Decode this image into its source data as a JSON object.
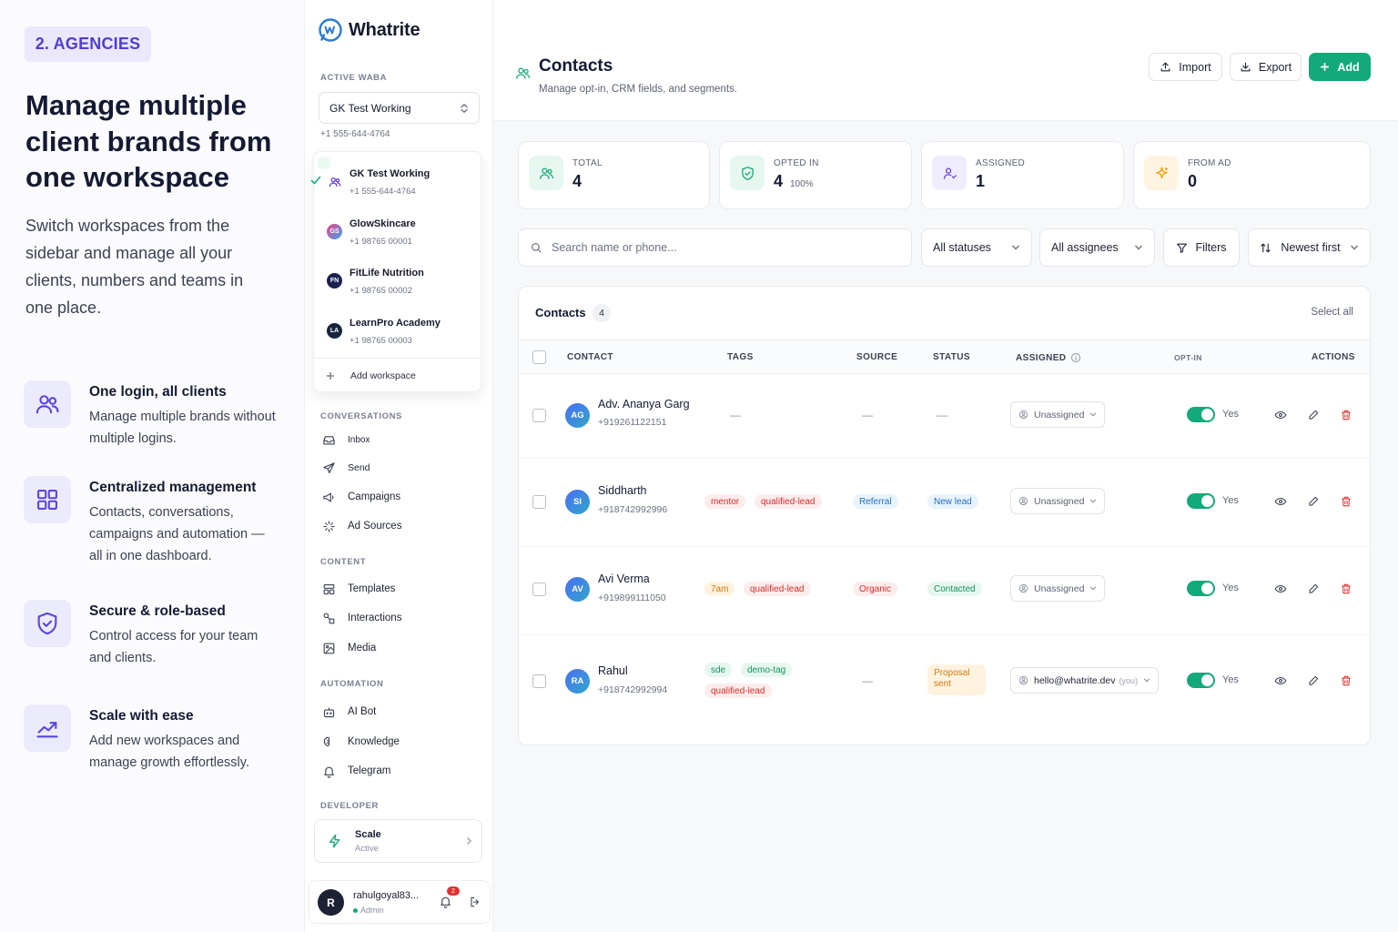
{
  "marketing": {
    "badge": "2. AGENCIES",
    "headline": "Manage multiple client brands from one workspace",
    "lead": "Switch workspaces from the sidebar and manage all your clients, numbers and teams in one place.",
    "features": [
      {
        "icon": "users-icon",
        "title": "One login, all clients",
        "desc": "Manage multiple brands without multiple logins."
      },
      {
        "icon": "grid-icon",
        "title": "Centralized management",
        "desc": "Contacts, conversations, campaigns and automation — all in one dashboard."
      },
      {
        "icon": "shield-check-icon",
        "title": "Secure & role-based",
        "desc": "Control access for your team and clients."
      },
      {
        "icon": "trend-up-icon",
        "title": "Scale with ease",
        "desc": "Add new workspaces and manage growth effortlessly."
      }
    ]
  },
  "sidebar": {
    "brand": "Whatrite",
    "active_waba_label": "ACTIVE WABA",
    "selected_workspace": "GK Test Working",
    "selected_phone": "+1 555-644-4764",
    "workspaces": [
      {
        "name": "GK Test Working",
        "phone": "+1 555-644-4764",
        "initials": "",
        "active": true
      },
      {
        "name": "GlowSkincare",
        "phone": "+1 98765 00001",
        "initials": "GS",
        "color": "#e0447a"
      },
      {
        "name": "FitLife Nutrition",
        "phone": "+1 98765 00002",
        "initials": "FN",
        "color": "#1b2150"
      },
      {
        "name": "LearnPro Academy",
        "phone": "+1 98765 00003",
        "initials": "LA",
        "color": "#16253f"
      }
    ],
    "add_workspace": "Add workspace",
    "sections": {
      "conversations": "CONVERSATIONS",
      "content": "CONTENT",
      "automation": "AUTOMATION",
      "developer": "DEVELOPER"
    },
    "nav": {
      "inbox": "Inbox",
      "send": "Send",
      "campaigns": "Campaigns",
      "ad_sources": "Ad Sources",
      "templates": "Templates",
      "interactions": "Interactions",
      "media": "Media",
      "ai_bot": "AI Bot",
      "knowledge": "Knowledge",
      "telegram": "Telegram"
    },
    "plan": {
      "name": "Scale",
      "status": "Active"
    },
    "user": {
      "initial": "R",
      "name": "rahulgoyal83...",
      "role": "Admin",
      "notifications": "2"
    }
  },
  "page": {
    "title": "Contacts",
    "subtitle": "Manage opt-in, CRM fields, and segments.",
    "buttons": {
      "import": "Import",
      "export": "Export",
      "add": "Add"
    }
  },
  "stats": [
    {
      "label": "TOTAL",
      "value": "4",
      "extra": ""
    },
    {
      "label": "OPTED IN",
      "value": "4",
      "extra": "100%"
    },
    {
      "label": "ASSIGNED",
      "value": "1",
      "extra": ""
    },
    {
      "label": "FROM AD",
      "value": "0",
      "extra": ""
    }
  ],
  "filters": {
    "search_placeholder": "Search name or phone...",
    "status": "All statuses",
    "assignees": "All assignees",
    "filters": "Filters",
    "sort": "Newest first"
  },
  "table": {
    "title": "Contacts",
    "count": "4",
    "select_all": "Select all",
    "columns": [
      "CONTACT",
      "TAGS",
      "SOURCE",
      "STATUS",
      "ASSIGNED",
      "OPT-IN",
      "ACTIONS"
    ],
    "rows": [
      {
        "initials": "AG",
        "name": "Adv. Ananya Garg",
        "phone": "+919261122151",
        "tags": [],
        "source": "—",
        "status": "—",
        "assigned": "Unassigned",
        "optin": "Yes"
      },
      {
        "initials": "SI",
        "name": "Siddharth",
        "phone": "+918742992996",
        "tags": [
          "mentor",
          "qualified-lead"
        ],
        "source": "Referral",
        "status": "New lead",
        "assigned": "Unassigned",
        "optin": "Yes"
      },
      {
        "initials": "AV",
        "name": "Avi Verma",
        "phone": "+919899111050",
        "tags": [
          "7am",
          "qualified-lead"
        ],
        "source": "Organic",
        "status": "Contacted",
        "assigned": "Unassigned",
        "optin": "Yes"
      },
      {
        "initials": "RA",
        "name": "Rahul",
        "phone": "+918742992994",
        "tags": [
          "sde",
          "demo-tag",
          "qualified-lead"
        ],
        "source": "—",
        "status": "Proposal sent",
        "assigned": "hello@whatrite.dev",
        "assigned_suffix": "(you)",
        "optin": "Yes"
      }
    ],
    "empty_dash": "—"
  },
  "colors": {
    "accent": "#13a97a",
    "brand_purple": "#4f3ed6",
    "danger": "#e03131"
  }
}
